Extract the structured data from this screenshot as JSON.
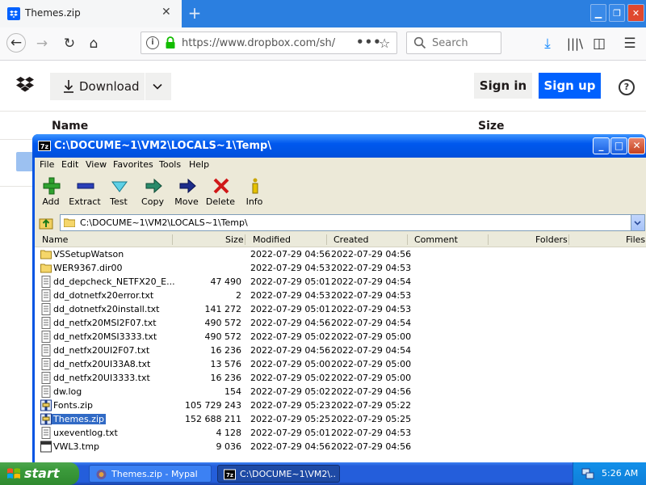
{
  "browser": {
    "tab_title": "Themes.zip",
    "new_tab": "+",
    "url": "https://www.dropbox.com/sh/",
    "search_placeholder": "Search",
    "accent": "#2b7fe0"
  },
  "dropbox": {
    "download_label": "Download",
    "signin_label": "Sign in",
    "signup_label": "Sign up",
    "help": "?",
    "columns": {
      "name": "Name",
      "size": "Size"
    },
    "brand_color": "#0061fe"
  },
  "zip_window": {
    "title": "C:\\DOCUME~1\\VM2\\LOCALS~1\\Temp\\",
    "app_icon": "7z",
    "menu": [
      "File",
      "Edit",
      "View",
      "Favorites",
      "Tools",
      "Help"
    ],
    "toolbar": [
      "Add",
      "Extract",
      "Test",
      "Copy",
      "Move",
      "Delete",
      "Info"
    ],
    "address": "C:\\DOCUME~1\\VM2\\LOCALS~1\\Temp\\",
    "headers": [
      "Name",
      "Size",
      "Modified",
      "Created",
      "Comment",
      "Folders",
      "Files"
    ],
    "rows": [
      {
        "name": "VSSetupWatson",
        "size": "",
        "modified": "2022-07-29 04:56",
        "created": "2022-07-29 04:56",
        "icon": "folder-icon"
      },
      {
        "name": "WER9367.dir00",
        "size": "",
        "modified": "2022-07-29 04:53",
        "created": "2022-07-29 04:53",
        "icon": "folder-icon"
      },
      {
        "name": "dd_depcheck_NETFX20_E...",
        "size": "47 490",
        "modified": "2022-07-29 05:01",
        "created": "2022-07-29 04:54",
        "icon": "text-file-icon"
      },
      {
        "name": "dd_dotnetfx20error.txt",
        "size": "2",
        "modified": "2022-07-29 04:53",
        "created": "2022-07-29 04:53",
        "icon": "text-file-icon"
      },
      {
        "name": "dd_dotnetfx20install.txt",
        "size": "141 272",
        "modified": "2022-07-29 05:01",
        "created": "2022-07-29 04:53",
        "icon": "text-file-icon"
      },
      {
        "name": "dd_netfx20MSI2F07.txt",
        "size": "490 572",
        "modified": "2022-07-29 04:56",
        "created": "2022-07-29 04:54",
        "icon": "text-file-icon"
      },
      {
        "name": "dd_netfx20MSI3333.txt",
        "size": "490 572",
        "modified": "2022-07-29 05:02",
        "created": "2022-07-29 05:00",
        "icon": "text-file-icon"
      },
      {
        "name": "dd_netfx20UI2F07.txt",
        "size": "16 236",
        "modified": "2022-07-29 04:56",
        "created": "2022-07-29 04:54",
        "icon": "text-file-icon"
      },
      {
        "name": "dd_netfx20UI33A8.txt",
        "size": "13 576",
        "modified": "2022-07-29 05:00",
        "created": "2022-07-29 05:00",
        "icon": "text-file-icon"
      },
      {
        "name": "dd_netfx20UI3333.txt",
        "size": "16 236",
        "modified": "2022-07-29 05:02",
        "created": "2022-07-29 05:00",
        "icon": "text-file-icon"
      },
      {
        "name": "dw.log",
        "size": "154",
        "modified": "2022-07-29 05:02",
        "created": "2022-07-29 04:56",
        "icon": "text-file-icon"
      },
      {
        "name": "Fonts.zip",
        "size": "105 729 243",
        "modified": "2022-07-29 05:23",
        "created": "2022-07-29 05:22",
        "icon": "zip-file-icon"
      },
      {
        "name": "Themes.zip",
        "size": "152 688 211",
        "modified": "2022-07-29 05:25",
        "created": "2022-07-29 05:25",
        "icon": "zip-file-icon",
        "selected": true
      },
      {
        "name": "uxeventlog.txt",
        "size": "4 128",
        "modified": "2022-07-29 05:01",
        "created": "2022-07-29 04:53",
        "icon": "text-file-icon"
      },
      {
        "name": "VWL3.tmp",
        "size": "9 036",
        "modified": "2022-07-29 04:56",
        "created": "2022-07-29 04:56",
        "icon": "tmp-file-icon"
      }
    ]
  },
  "taskbar": {
    "start_label": "start",
    "tasks": [
      "Themes.zip - Mypal",
      "C:\\DOCUME~1\\VM2\\..."
    ],
    "clock": "5:26 AM"
  }
}
